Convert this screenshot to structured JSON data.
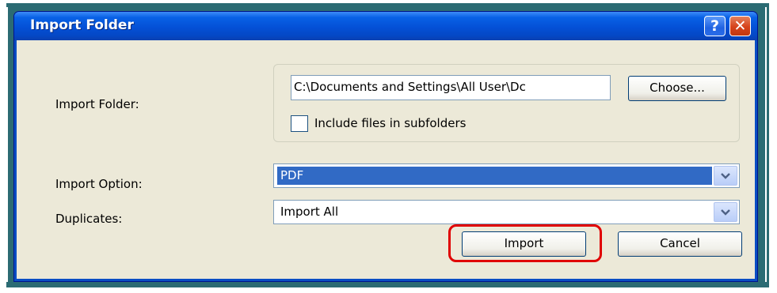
{
  "window": {
    "title": "Import Folder",
    "help_glyph": "?",
    "close_glyph": "✕"
  },
  "form": {
    "folder_label": "Import Folder:",
    "folder_path": "C:\\Documents and Settings\\All User\\Dc",
    "choose_label": "Choose...",
    "include_subfolders_label": "Include files in subfolders",
    "include_subfolders_checked": false,
    "option_label": "Import Option:",
    "option_value": "PDF",
    "duplicates_label": "Duplicates:",
    "duplicates_value": "Import All"
  },
  "buttons": {
    "import_label": "Import",
    "cancel_label": "Cancel"
  },
  "icons": {
    "dropdown": "chevron-down-icon"
  },
  "colors": {
    "titlebar": "#0450d6",
    "client": "#ece9d8",
    "selection": "#316ac5",
    "highlight": "#e00000",
    "frame": "#2b6b73"
  }
}
